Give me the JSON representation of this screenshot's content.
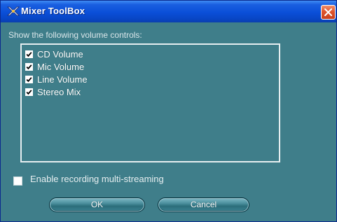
{
  "window": {
    "title": "Mixer ToolBox",
    "icon": "mixer-toolbox-icon",
    "close_icon": "close-icon"
  },
  "dialog": {
    "prompt": "Show the following volume controls:",
    "items": [
      {
        "label": "CD Volume",
        "checked": true
      },
      {
        "label": "Mic Volume",
        "checked": true
      },
      {
        "label": "Line Volume",
        "checked": true
      },
      {
        "label": "Stereo Mix",
        "checked": true
      }
    ],
    "multistream": {
      "label": "Enable recording multi-streaming",
      "checked": false
    }
  },
  "buttons": {
    "ok_label": "OK",
    "cancel_label": "Cancel"
  },
  "colors": {
    "titlebar": "#0a4fd8",
    "body": "#3f7e8a",
    "close": "#e0542c"
  }
}
